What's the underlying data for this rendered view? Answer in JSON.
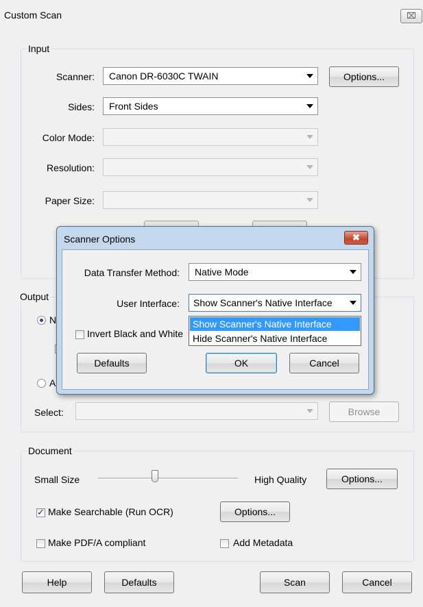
{
  "window": {
    "title": "Custom Scan",
    "close_glyph": "⌧"
  },
  "input_group": {
    "label": "Input",
    "scanner_label": "Scanner:",
    "scanner_value": "Canon DR-6030C TWAIN",
    "options_button": "Options...",
    "sides_label": "Sides:",
    "sides_value": "Front Sides",
    "color_mode_label": "Color Mode:",
    "resolution_label": "Resolution:",
    "paper_size_label": "Paper Size:"
  },
  "output_group": {
    "label": "Output",
    "radio1_partial": "N",
    "radio2_partial": "Ap",
    "select_label": "Select:",
    "browse_button": "Browse"
  },
  "document_group": {
    "label": "Document",
    "small_size": "Small Size",
    "high_quality": "High Quality",
    "options_button": "Options...",
    "make_searchable": "Make Searchable (Run OCR)",
    "make_searchable_checked": true,
    "ocr_options_button": "Options...",
    "pdfa": "Make PDF/A compliant",
    "pdfa_checked": false,
    "add_metadata": "Add Metadata",
    "add_metadata_checked": false
  },
  "footer": {
    "help": "Help",
    "defaults": "Defaults",
    "scan": "Scan",
    "cancel": "Cancel"
  },
  "scanner_options_dialog": {
    "title": "Scanner Options",
    "close_glyph": "✖",
    "data_transfer_label": "Data Transfer Method:",
    "data_transfer_value": "Native Mode",
    "user_interface_label": "User Interface:",
    "user_interface_value": "Show Scanner's Native Interface",
    "user_interface_options": [
      "Show Scanner's Native Interface",
      "Hide Scanner's Native Interface"
    ],
    "invert_label": "Invert Black and White",
    "invert_checked": false,
    "defaults_button": "Defaults",
    "ok_button": "OK",
    "cancel_button": "Cancel"
  },
  "colors": {
    "accent_selection": "#3399ff",
    "dialog_frame": "#c3d8ec",
    "close_red": "#c2472d"
  }
}
